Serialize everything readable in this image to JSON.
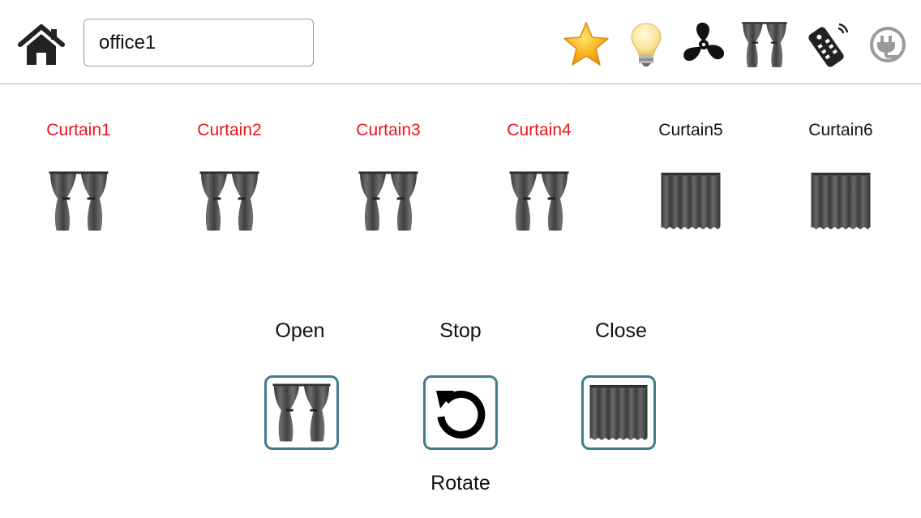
{
  "header": {
    "room_value": "office1",
    "icons": [
      "home-icon",
      "star-icon",
      "lightbulb-icon",
      "fan-icon",
      "curtain-icon",
      "remote-icon",
      "power-plug-icon"
    ]
  },
  "curtains": [
    {
      "label": "Curtain1",
      "state": "open",
      "color": "#e8141c"
    },
    {
      "label": "Curtain2",
      "state": "open",
      "color": "#e8141c"
    },
    {
      "label": "Curtain3",
      "state": "open",
      "color": "#e8141c"
    },
    {
      "label": "Curtain4",
      "state": "open",
      "color": "#e8141c"
    },
    {
      "label": "Curtain5",
      "state": "closed",
      "color": "#111111"
    },
    {
      "label": "Curtain6",
      "state": "closed",
      "color": "#111111"
    }
  ],
  "controls": {
    "open_label": "Open",
    "stop_label": "Stop",
    "close_label": "Close",
    "rotate_label": "Rotate"
  },
  "colors": {
    "selected": "#e8141c",
    "button_border": "#3f7c8c"
  }
}
